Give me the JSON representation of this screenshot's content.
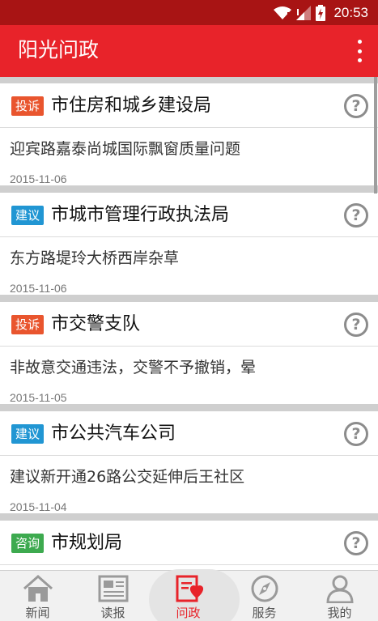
{
  "status": {
    "time": "20:53"
  },
  "app": {
    "title": "阳光问政"
  },
  "items": [
    {
      "tag": "投诉",
      "tag_color": "#e9552e",
      "dept": "市住房和城乡建设局",
      "summary": "迎宾路嘉泰尚城国际飘窗质量问题",
      "date": "2015-11-06"
    },
    {
      "tag": "建议",
      "tag_color": "#2196d3",
      "dept": "市城市管理行政执法局",
      "summary": "东方路堤玲大桥西岸杂草",
      "date": "2015-11-06"
    },
    {
      "tag": "投诉",
      "tag_color": "#e9552e",
      "dept": "市交警支队",
      "summary": "非故意交通违法，交警不予撤销，晕",
      "date": "2015-11-05"
    },
    {
      "tag": "建议",
      "tag_color": "#2196d3",
      "dept": "市公共汽车公司",
      "summary": "建议新开通26路公交延伸后王社区",
      "date": "2015-11-04"
    },
    {
      "tag": "咨询",
      "tag_color": "#3daa4f",
      "dept": "市规划局",
      "summary": "",
      "date": ""
    }
  ],
  "tabs": [
    {
      "label": "新闻",
      "icon": "house-icon"
    },
    {
      "label": "读报",
      "icon": "newspaper-icon"
    },
    {
      "label": "问政",
      "icon": "heart-document-icon",
      "active": true
    },
    {
      "label": "服务",
      "icon": "compass-icon"
    },
    {
      "label": "我的",
      "icon": "person-icon"
    }
  ],
  "colors": {
    "status_bar": "#a81414",
    "app_bar": "#e8232a",
    "active_tab": "#e8232a"
  }
}
